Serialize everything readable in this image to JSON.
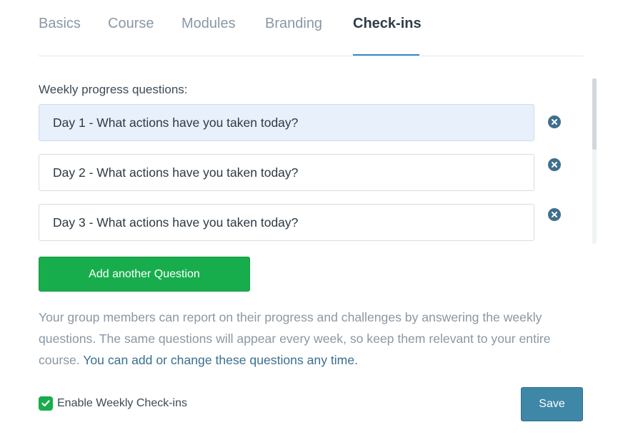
{
  "tabs": [
    {
      "label": "Basics",
      "active": false
    },
    {
      "label": "Course",
      "active": false
    },
    {
      "label": "Modules",
      "active": false
    },
    {
      "label": "Branding",
      "active": false
    },
    {
      "label": "Check-ins",
      "active": true
    }
  ],
  "checkins": {
    "section_label": "Weekly progress questions:",
    "questions": [
      {
        "value": "Day 1 - What actions have you taken today?",
        "focused": true,
        "remove_icon": "close-circle-icon"
      },
      {
        "value": "Day 2 - What actions have you taken today?",
        "focused": false,
        "remove_icon": "close-circle-icon"
      },
      {
        "value": "Day 3 - What actions have you taken today?",
        "focused": false,
        "remove_icon": "close-circle-icon"
      }
    ],
    "add_button_label": "Add another Question",
    "help_text": "Your group members can report on their progress and challenges by answering the weekly questions. The same questions will appear every week, so keep them relevant to your entire course.",
    "help_link": "You can add or change these questions any time.",
    "enable_label": "Enable Weekly Check-ins",
    "enable_checked": true,
    "save_label": "Save"
  },
  "colors": {
    "accent_tab_underline": "#2f8fd0",
    "add_button": "#18ad4c",
    "save_button": "#3f87a6",
    "link": "#3a6f8e",
    "focused_input_bg": "#e7f0fb"
  }
}
